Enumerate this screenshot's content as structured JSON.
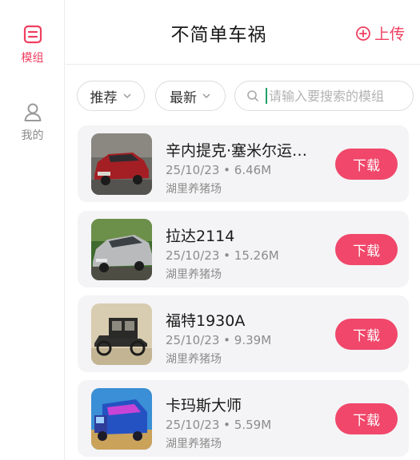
{
  "header": {
    "title": "不简单车祸",
    "upload_label": "上传"
  },
  "sidebar": {
    "items": [
      {
        "label": "模组",
        "icon": "mod-list-icon",
        "active": true
      },
      {
        "label": "我的",
        "icon": "user-icon",
        "active": false
      }
    ]
  },
  "filters": {
    "recommend_label": "推荐",
    "latest_label": "最新",
    "search_placeholder": "请输入要搜索的模组"
  },
  "mods": [
    {
      "title": "辛内提克·塞米尔运…",
      "date": "25/10/23",
      "size": "6.46M",
      "author": "湖里养猪场",
      "download_label": "下载"
    },
    {
      "title": "拉达2114",
      "date": "25/10/23",
      "size": "15.26M",
      "author": "湖里养猪场",
      "download_label": "下载"
    },
    {
      "title": "福特1930A",
      "date": "25/10/23",
      "size": "9.39M",
      "author": "湖里养猪场",
      "download_label": "下载"
    },
    {
      "title": "卡玛斯大师",
      "date": "25/10/23",
      "size": "5.59M",
      "author": "湖里养猪场",
      "download_label": "下载"
    }
  ],
  "meta_separator": "•",
  "colors": {
    "accent": "#ef3f5f",
    "button": "#f0476a",
    "card_bg": "#f4f4f6"
  }
}
